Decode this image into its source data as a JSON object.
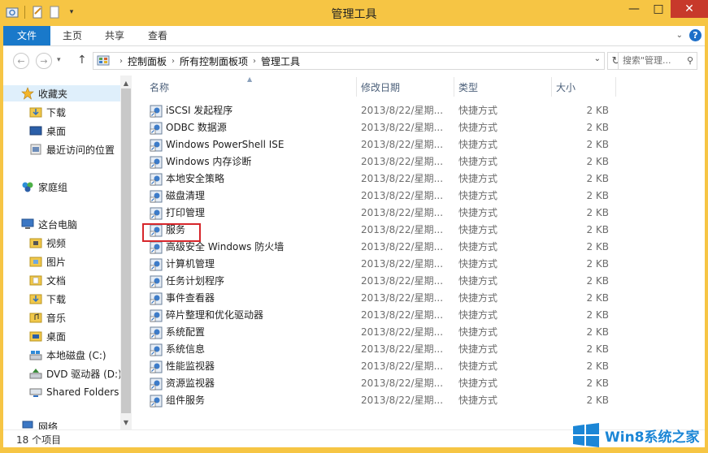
{
  "window": {
    "title": "管理工具",
    "buttons": {
      "minimize": "—",
      "maximize": "□",
      "close": "✕"
    }
  },
  "ribbon": {
    "tabs": [
      "文件",
      "主页",
      "共享",
      "查看"
    ]
  },
  "address": {
    "crumbs": [
      "控制面板",
      "所有控制面板项",
      "管理工具"
    ],
    "search_placeholder": "搜索\"管理...",
    "search_icon": "search-icon"
  },
  "nav": {
    "items": [
      {
        "label": "收藏夹",
        "icon": "star-icon"
      },
      {
        "label": "下载",
        "icon": "download-folder-icon"
      },
      {
        "label": "桌面",
        "icon": "desktop-icon"
      },
      {
        "label": "最近访问的位置",
        "icon": "recent-places-icon"
      },
      {
        "label": "家庭组",
        "icon": "homegroup-icon"
      },
      {
        "label": "这台电脑",
        "icon": "computer-icon"
      },
      {
        "label": "视频",
        "icon": "folder-icon"
      },
      {
        "label": "图片",
        "icon": "folder-icon"
      },
      {
        "label": "文档",
        "icon": "folder-icon"
      },
      {
        "label": "下载",
        "icon": "download-folder-icon"
      },
      {
        "label": "音乐",
        "icon": "music-folder-icon"
      },
      {
        "label": "桌面",
        "icon": "folder-icon"
      },
      {
        "label": "本地磁盘 (C:)",
        "icon": "drive-icon"
      },
      {
        "label": "DVD 驱动器 (D:)",
        "icon": "dvd-drive-icon"
      },
      {
        "label": "Shared Folders",
        "icon": "network-folder-icon"
      },
      {
        "label": "网络",
        "icon": "network-icon"
      }
    ]
  },
  "list": {
    "columns": [
      "名称",
      "修改日期",
      "类型",
      "大小"
    ],
    "rows": [
      {
        "name": "iSCSI 发起程序",
        "date": "2013/8/22/星期...",
        "type": "快捷方式",
        "size": "2 KB"
      },
      {
        "name": "ODBC 数据源",
        "date": "2013/8/22/星期...",
        "type": "快捷方式",
        "size": "2 KB"
      },
      {
        "name": "Windows PowerShell ISE",
        "date": "2013/8/22/星期...",
        "type": "快捷方式",
        "size": "2 KB"
      },
      {
        "name": "Windows 内存诊断",
        "date": "2013/8/22/星期...",
        "type": "快捷方式",
        "size": "2 KB"
      },
      {
        "name": "本地安全策略",
        "date": "2013/8/22/星期...",
        "type": "快捷方式",
        "size": "2 KB"
      },
      {
        "name": "磁盘清理",
        "date": "2013/8/22/星期...",
        "type": "快捷方式",
        "size": "2 KB"
      },
      {
        "name": "打印管理",
        "date": "2013/8/22/星期...",
        "type": "快捷方式",
        "size": "2 KB"
      },
      {
        "name": "服务",
        "date": "2013/8/22/星期...",
        "type": "快捷方式",
        "size": "2 KB"
      },
      {
        "name": "高级安全 Windows 防火墙",
        "date": "2013/8/22/星期...",
        "type": "快捷方式",
        "size": "2 KB"
      },
      {
        "name": "计算机管理",
        "date": "2013/8/22/星期...",
        "type": "快捷方式",
        "size": "2 KB"
      },
      {
        "name": "任务计划程序",
        "date": "2013/8/22/星期...",
        "type": "快捷方式",
        "size": "2 KB"
      },
      {
        "name": "事件查看器",
        "date": "2013/8/22/星期...",
        "type": "快捷方式",
        "size": "2 KB"
      },
      {
        "name": "碎片整理和优化驱动器",
        "date": "2013/8/22/星期...",
        "type": "快捷方式",
        "size": "2 KB"
      },
      {
        "name": "系统配置",
        "date": "2013/8/22/星期...",
        "type": "快捷方式",
        "size": "2 KB"
      },
      {
        "name": "系统信息",
        "date": "2013/8/22/星期...",
        "type": "快捷方式",
        "size": "2 KB"
      },
      {
        "name": "性能监视器",
        "date": "2013/8/22/星期...",
        "type": "快捷方式",
        "size": "2 KB"
      },
      {
        "name": "资源监视器",
        "date": "2013/8/22/星期...",
        "type": "快捷方式",
        "size": "2 KB"
      },
      {
        "name": "组件服务",
        "date": "2013/8/22/星期...",
        "type": "快捷方式",
        "size": "2 KB"
      }
    ],
    "highlighted_item": "服务",
    "highlight_color": "#d6262b"
  },
  "status": {
    "count": "18 个项目"
  },
  "watermark": {
    "text": "Win8系统之家"
  },
  "colors": {
    "title_bar": "#f6c544",
    "file_tab": "#1979ca",
    "close_button": "#c7392b",
    "column_header": "#4c607a"
  }
}
